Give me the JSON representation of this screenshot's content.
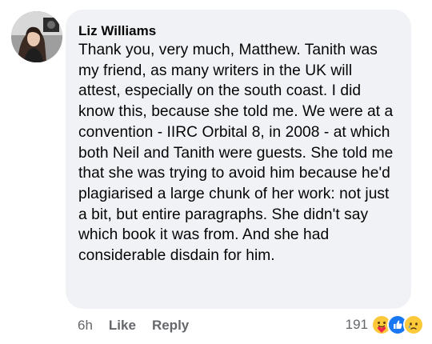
{
  "comment": {
    "author": "Liz Williams",
    "text": "Thank you, very much, Matthew. Tanith was my friend, as many writers in the UK will attest, especially on the south coast. I did know this, because she told me. We were at a convention - IIRC Orbital 8, in 2008 - at which both Neil and Tanith were guests. She told me that she was trying to avoid him because he'd plagiarised a large chunk of her work: not just a bit, but entire paragraphs. She didn't say which book it was from. And she had considerable disdain for him.",
    "avatar_icon": "profile-photo"
  },
  "actions": {
    "time": "6h",
    "like_label": "Like",
    "reply_label": "Reply"
  },
  "reactions": {
    "count": "191",
    "icons": [
      "care-icon",
      "like-icon",
      "sad-icon"
    ]
  },
  "colors": {
    "bubble": "#f0f2f5",
    "text": "#050505",
    "secondary_text": "#65676b",
    "like_blue": "#1877f2",
    "emoji_yellow": "#fcc93b"
  }
}
